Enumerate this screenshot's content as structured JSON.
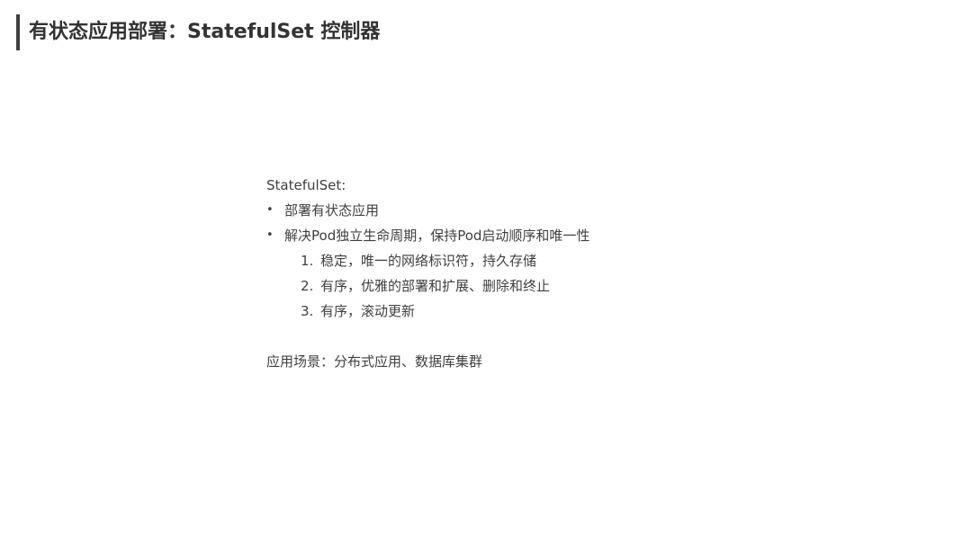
{
  "slide": {
    "title": "有状态应用部署：StatefulSet 控制器"
  },
  "content": {
    "heading": "StatefulSet:",
    "bullets": [
      {
        "marker": "•",
        "text": "部署有状态应用"
      },
      {
        "marker": "•",
        "text": "解决Pod独立生命周期，保持Pod启动顺序和唯一性"
      }
    ],
    "numbered": [
      {
        "marker": "1.",
        "text": "稳定，唯一的网络标识符，持久存储"
      },
      {
        "marker": "2.",
        "text": "有序，优雅的部署和扩展、删除和终止"
      },
      {
        "marker": "3.",
        "text": "有序，滚动更新"
      }
    ],
    "scenario": "应用场景：分布式应用、数据库集群"
  }
}
